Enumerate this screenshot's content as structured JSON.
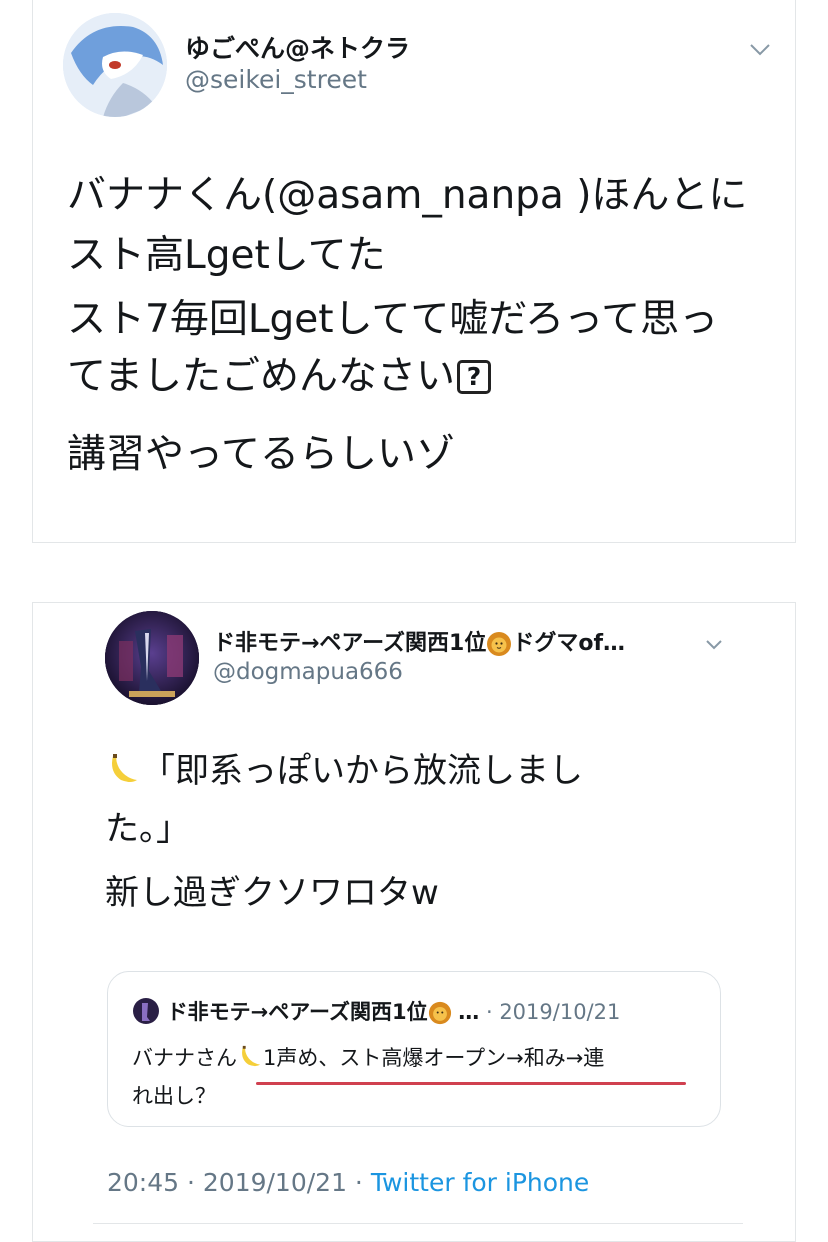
{
  "tweet1": {
    "display_name": "ゆごぺん@ネトクラ",
    "handle": "@seikei_street",
    "lines": [
      "バナナくん(@asam_nanpa )ほんとに",
      "スト高Lgetしてた",
      "スト7毎回Lgetしてて嘘だろって思っ",
      "てましたごめんなさい"
    ],
    "qmark": "?",
    "last_line": "講習やってるらしいゾ"
  },
  "tweet2": {
    "display_name_a": "ド非モテ→ペアーズ関西1位",
    "display_name_b": "ドグマof…",
    "handle": "@dogmapua666",
    "line1": "「即系っぽいから放流しまし",
    "line2": "た。」",
    "line3": "新し過ぎクソワロタw",
    "quoted": {
      "display_name": "ド非モテ→ペアーズ関西1位",
      "ellipsis": "…",
      "date": "· 2019/10/21",
      "line1_a": "バナナさん",
      "line1_b": "1声め、スト高爆オープン→和み→連",
      "line2": "れ出し？"
    },
    "footer": {
      "time": "20:45 · 2019/10/21 · ",
      "client": "Twitter for iPhone"
    }
  },
  "colors": {
    "name_text": "#14171a",
    "secondary_text": "#657786",
    "link": "#1b95e0",
    "underline_mark": "#d0404f",
    "card_border": "#e3e6e8"
  },
  "icons": [
    "chevron-down-icon",
    "banana-emoji",
    "lion-emoji",
    "question-mark-emoji"
  ]
}
